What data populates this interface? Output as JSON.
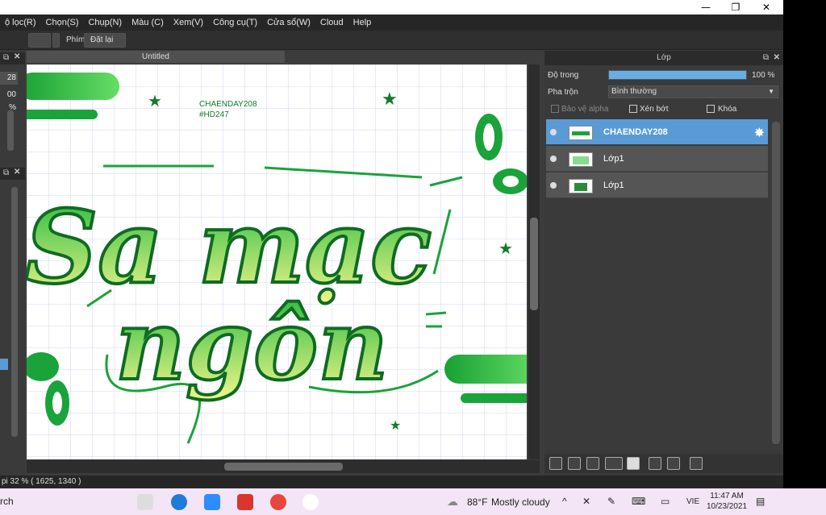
{
  "window": {
    "minimize": "—",
    "maximize": "❐",
    "close": "✕"
  },
  "menu": [
    "ộ lọc(R)",
    "Chọn(S)",
    "Chụp(N)",
    "Màu (C)",
    "Xem(V)",
    "Công cụ(T)",
    "Cửa sổ(W)",
    "Cloud",
    "Help"
  ],
  "toolbar": {
    "key_label": "Phím",
    "reset_label": "Đặt lại"
  },
  "left_panel": {
    "value1": "28",
    "value2": "00 %"
  },
  "canvas": {
    "tab_title": "Untitled",
    "caption_line1": "CHAENDAY208",
    "caption_line2": "#HD247",
    "art_word1": "Sa mạc",
    "art_word2": "ngôn"
  },
  "status": {
    "text": "pi  32 %  ( 1625, 1340 )"
  },
  "layers_panel": {
    "title": "Lớp",
    "opacity_label": "Độ trong",
    "opacity_value": "100 %",
    "opacity_level": 1.0,
    "blend_label": "Pha trộn",
    "blend_value": "Bình thường",
    "protect_alpha": "Bảo vệ alpha",
    "clip": "Xén bớt",
    "lock": "Khóa",
    "layers": [
      {
        "name": "CHAENDAY208",
        "selected": true
      },
      {
        "name": "Lớp1",
        "selected": false
      },
      {
        "name": "Lớp1",
        "selected": false
      }
    ]
  },
  "taskbar": {
    "search": "rch",
    "temperature": "88°F",
    "weather": "Mostly cloudy",
    "language": "VIE",
    "time": "11:47 AM",
    "date": "10/23/2021"
  },
  "colors": {
    "accent": "#5b9bd5",
    "art_green": "#1faa3a",
    "art_yellow": "#f2f58a",
    "opacity_fill": "#67aee6"
  }
}
